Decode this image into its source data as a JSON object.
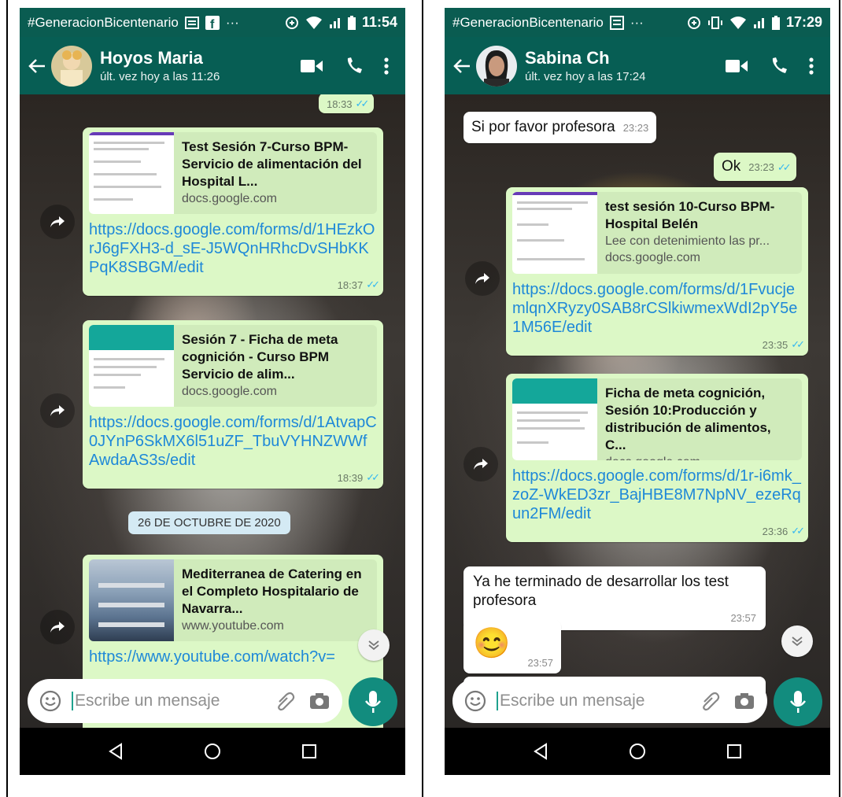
{
  "phone1": {
    "status": {
      "tagline": "#GeneracionBicentenario",
      "time": "11:54"
    },
    "header": {
      "name": "Hoyos Maria",
      "last_seen": "últ. vez hoy a las 11:26"
    },
    "top_time": "18:33",
    "msg1": {
      "title": "Test Sesión 7-Curso BPM-Servicio de alimentación del Hospital L...",
      "domain": "docs.google.com",
      "link": "https://docs.google.com/forms/d/1HEzkOrJ6gFXH3-d_sE-J5WQnHRhcDvSHbKKPqK8SBGM/edit",
      "time": "18:37"
    },
    "msg2": {
      "title": "Sesión 7 - Ficha  de meta cognición - Curso BPM Servicio de alim...",
      "domain": "docs.google.com",
      "link": "https://docs.google.com/forms/d/1AtvapC0JYnP6SkMX6l51uZF_TbuVYHNZWWfAwdaAS3s/edit",
      "time": "18:39"
    },
    "date_chip": "26 DE OCTUBRE DE 2020",
    "msg3": {
      "title": "Mediterranea de Catering en el Completo Hospitalario de Navarra...",
      "domain": "www.youtube.com",
      "link": "https://www.youtube.com/watch?v="
    },
    "input_placeholder": "Escribe un mensaje"
  },
  "phone2": {
    "status": {
      "tagline": "#GeneracionBicentenario",
      "time": "17:29"
    },
    "header": {
      "name": "Sabina Ch",
      "last_seen": "últ. vez hoy a las 17:24"
    },
    "in1": {
      "text": "Si por favor profesora",
      "time": "23:23"
    },
    "out1": {
      "text": "Ok",
      "time": "23:23"
    },
    "msg1": {
      "title": "test sesión 10-Curso BPM-Hospital Belén",
      "desc": "Lee con detenimiento las pr...",
      "domain": "docs.google.com",
      "link": "https://docs.google.com/forms/d/1FvucjemlqnXRyzy0SAB8rCSlkiwmexWdI2pY5e1M56E/edit",
      "time": "23:35"
    },
    "msg2": {
      "title": "Ficha  de meta cognición, Sesión 10:Producción y distribución de alimentos, C...",
      "domain": "docs.google.com",
      "link": "https://docs.google.com/forms/d/1r-i6mk_zoZ-WkED3zr_BajHBE8M7NpNV_ezeRqun2FM/edit",
      "time": "23:36"
    },
    "in2": {
      "text": "Ya he terminado de desarrollar los test profesora",
      "time": "23:57"
    },
    "in3": {
      "emoji": "😊",
      "time": "23:57"
    },
    "input_placeholder": "Escribe un mensaje"
  },
  "colors": {
    "header": "#075e54",
    "statusbar": "#0a5c51",
    "outgoing": "#dcf8c6",
    "link": "#1e88d8",
    "ticks": "#34b7f1",
    "fab": "#128c7e"
  }
}
